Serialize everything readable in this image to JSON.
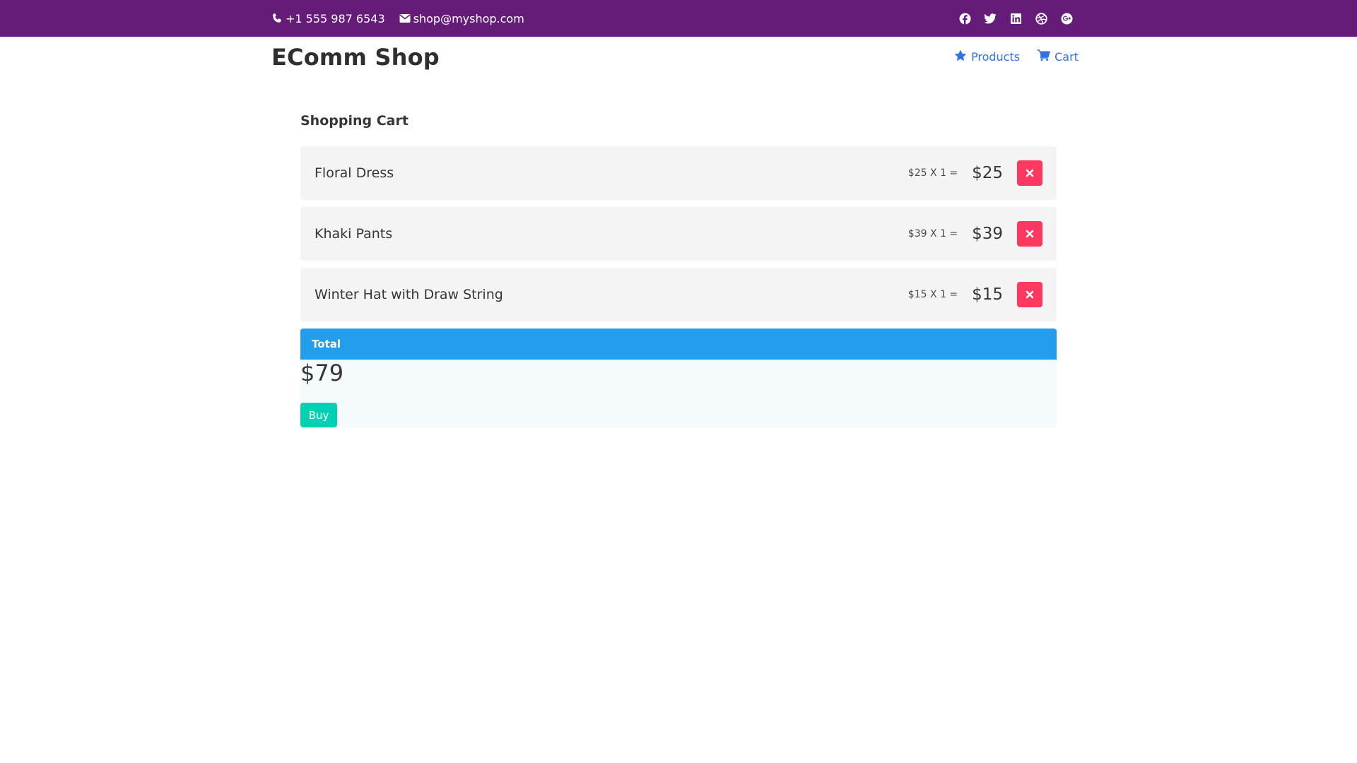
{
  "topbar": {
    "phone": "+1 555 987 6543",
    "email": "shop@myshop.com",
    "social_icons": [
      "facebook-icon",
      "twitter-icon",
      "linkedin-icon",
      "dribbble-icon",
      "google-plus-icon"
    ],
    "bg_color": "#641c78"
  },
  "header": {
    "brand": "EComm Shop",
    "nav": {
      "products_label": "Products",
      "cart_label": "Cart"
    },
    "link_color": "#3273dc"
  },
  "cart": {
    "title": "Shopping Cart",
    "items": [
      {
        "name": "Floral Dress",
        "calc": "$25 X 1 =",
        "price": "$25"
      },
      {
        "name": "Khaki Pants",
        "calc": "$39 X 1 =",
        "price": "$39"
      },
      {
        "name": "Winter Hat with Draw String",
        "calc": "$15 X 1 =",
        "price": "$15"
      }
    ],
    "remove_icon": "close-icon",
    "remove_color": "#ff3860"
  },
  "total": {
    "label": "Total",
    "amount": "$79",
    "buy_label": "Buy",
    "header_color": "#229eec",
    "buy_color": "#00d1b2"
  }
}
